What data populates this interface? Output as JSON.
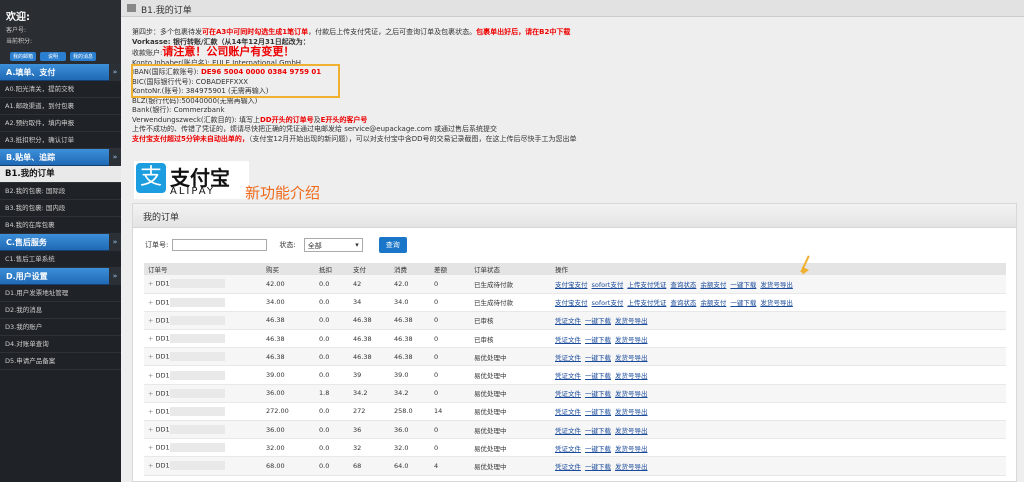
{
  "sidebar": {
    "welcome": "欢迎:",
    "customer_label": "客户号:",
    "points_label": "当前积分:",
    "buttons": [
      "我的邮箱",
      "说明",
      "我的消息"
    ],
    "sections": [
      {
        "label": "A.填单、支付",
        "items": [
          "A0.阳光清关，提前交税",
          "A1.邮政渠道，到付包裹",
          "A2.预约取件，填内申报",
          "A3.抵扣积分，确认订单"
        ]
      },
      {
        "label": "B.贴单、追踪",
        "items": [
          "B1.我的订单",
          "B2.我的包裹: 国际段",
          "B3.我的包裹: 国内段",
          "B4.我的在库包裹"
        ]
      },
      {
        "label": "C.售后服务",
        "items": [
          "C1.售后工单系统"
        ]
      },
      {
        "label": "D.用户设置",
        "items": [
          "D1.用户发票地址管理",
          "D2.我的消息",
          "D3.我的账户",
          "D4.对账单查询",
          "D5.申请产品备案"
        ]
      }
    ],
    "active_item": "B1.我的订单"
  },
  "topbar": {
    "title": "B1.我的订单"
  },
  "info": {
    "line1_a": "第四步：多个包裹待发",
    "line1_red": "可在A3中可同时勾选生成1笔订单",
    "line1_b": "，付款后上传支付凭证，之后可查询订单及包裹状态。",
    "line1_red2": "包裹单出好后，请在B2中下载",
    "vorkasse": "Vorkasse: 银行转账/汇款（从14年12月31日起改为：",
    "bank_label": "收款账户:",
    "notice": "请注意！公司账户有变更！",
    "inhaber": "Konto Inhaber(账户名): EULE International GmbH",
    "iban_label": "IBAN(国际汇款账号):",
    "iban": "DE96 5004 0000 0384 9759 01",
    "bic": "BIC(国际银行代号): COBADEFFXXX",
    "kontonr": "KontoNr.(账号): 384975901 (无需再输入)",
    "blz": "BLZ(银行代码):50040000(无需再输入)",
    "bank": "Bank(银行): Commerzbank",
    "zweck_a": "Verwendungszweck(汇款目的): 填写上",
    "zweck_red": "DD开头的订单号",
    "zweck_b": "及",
    "zweck_red2": "E开头的客户号",
    "upload": "上传不成功的、传错了凭证的，烦请尽快把正确的凭证通过电邮发给 service@eupackage.com 或通过售后系统提交",
    "alipay_red": "支付宝支付超过5分钟未自动出单的，",
    "alipay_b": "（支付宝12月开始出现的新问题），可以对支付宝中含DD号的交易记录截图，在这上传后尽快手工为您出单"
  },
  "alipay": {
    "zh": "支付宝",
    "en": "ALIPAY",
    "newfeature": "新功能介绍"
  },
  "panel": {
    "title": "我的订单",
    "order_label": "订单号:",
    "status_label": "状态:",
    "status_value": "全部",
    "query_button": "查询"
  },
  "table": {
    "headers": [
      "订单号",
      "购买",
      "抵扣",
      "支付",
      "消费",
      "差额",
      "订单状态",
      "操作"
    ],
    "rows": [
      {
        "id": "DD1",
        "buy": "42.00",
        "deduct": "0.0",
        "pay": "42",
        "spend": "42.0",
        "diff": "0",
        "status": "已生成待付款",
        "ops": [
          "支付宝支付",
          "sofort支付",
          "上传支付凭证",
          "查询状态",
          "余额支付",
          "一键下载",
          "发货号导出"
        ]
      },
      {
        "id": "DD1",
        "buy": "34.00",
        "deduct": "0.0",
        "pay": "34",
        "spend": "34.0",
        "diff": "0",
        "status": "已生成待付款",
        "ops": [
          "支付宝支付",
          "sofort支付",
          "上传支付凭证",
          "查询状态",
          "余额支付",
          "一键下载",
          "发货号导出"
        ]
      },
      {
        "id": "DD1",
        "buy": "46.38",
        "deduct": "0.0",
        "pay": "46.38",
        "spend": "46.38",
        "diff": "0",
        "status": "已审核",
        "ops": [
          "凭证文件",
          "一键下载",
          "发货号导出"
        ]
      },
      {
        "id": "DD1",
        "buy": "46.38",
        "deduct": "0.0",
        "pay": "46.38",
        "spend": "46.38",
        "diff": "0",
        "status": "已审核",
        "ops": [
          "凭证文件",
          "一键下载",
          "发货号导出"
        ]
      },
      {
        "id": "DD1",
        "buy": "46.38",
        "deduct": "0.0",
        "pay": "46.38",
        "spend": "46.38",
        "diff": "0",
        "status": "易优处理中",
        "ops": [
          "凭证文件",
          "一键下载",
          "发货号导出"
        ]
      },
      {
        "id": "DD1",
        "buy": "39.00",
        "deduct": "0.0",
        "pay": "39",
        "spend": "39.0",
        "diff": "0",
        "status": "易优处理中",
        "ops": [
          "凭证文件",
          "一键下载",
          "发货号导出"
        ]
      },
      {
        "id": "DD1",
        "buy": "36.00",
        "deduct": "1.8",
        "pay": "34.2",
        "spend": "34.2",
        "diff": "0",
        "status": "易优处理中",
        "ops": [
          "凭证文件",
          "一键下载",
          "发货号导出"
        ]
      },
      {
        "id": "DD1",
        "buy": "272.00",
        "deduct": "0.0",
        "pay": "272",
        "spend": "258.0",
        "diff": "14",
        "status": "易优处理中",
        "ops": [
          "凭证文件",
          "一键下载",
          "发货号导出"
        ]
      },
      {
        "id": "DD1",
        "buy": "36.00",
        "deduct": "0.0",
        "pay": "36",
        "spend": "36.0",
        "diff": "0",
        "status": "易优处理中",
        "ops": [
          "凭证文件",
          "一键下载",
          "发货号导出"
        ]
      },
      {
        "id": "DD1",
        "buy": "32.00",
        "deduct": "0.0",
        "pay": "32",
        "spend": "32.0",
        "diff": "0",
        "status": "易优处理中",
        "ops": [
          "凭证文件",
          "一键下载",
          "发货号导出"
        ]
      },
      {
        "id": "DD1",
        "buy": "68.00",
        "deduct": "0.0",
        "pay": "68",
        "spend": "64.0",
        "diff": "4",
        "status": "易优处理中",
        "ops": [
          "凭证文件",
          "一键下载",
          "发货号导出"
        ]
      }
    ]
  }
}
